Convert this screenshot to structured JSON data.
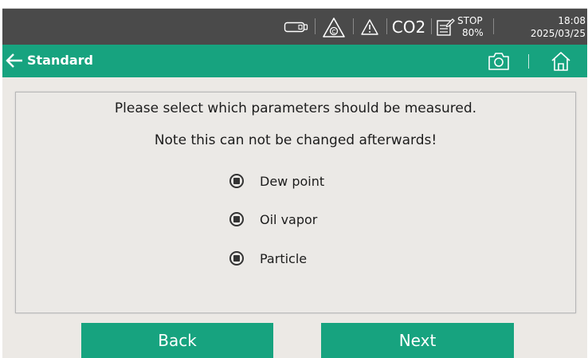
{
  "status_bar": {
    "co2": "CO2",
    "stop_label": "STOP",
    "stop_percent": "80%",
    "time": "18:08",
    "date": "2025/03/25",
    "icons": [
      "battery-card-icon",
      "sensor-warning-icon",
      "warning-icon",
      "log-edit-icon"
    ]
  },
  "header": {
    "title": "Standard",
    "icons": [
      "back-arrow-icon",
      "camera-icon",
      "home-icon"
    ]
  },
  "dialog": {
    "line1": "Please select which parameters should be measured.",
    "line2": "Note this can not be changed afterwards!",
    "options": [
      {
        "label": "Dew point",
        "selected": true
      },
      {
        "label": "Oil vapor",
        "selected": true
      },
      {
        "label": "Particle",
        "selected": true
      }
    ]
  },
  "buttons": {
    "back": "Back",
    "next": "Next"
  },
  "colors": {
    "accent": "#17a37f",
    "status_bar": "#4a4a4a",
    "background": "#ece9e5"
  }
}
